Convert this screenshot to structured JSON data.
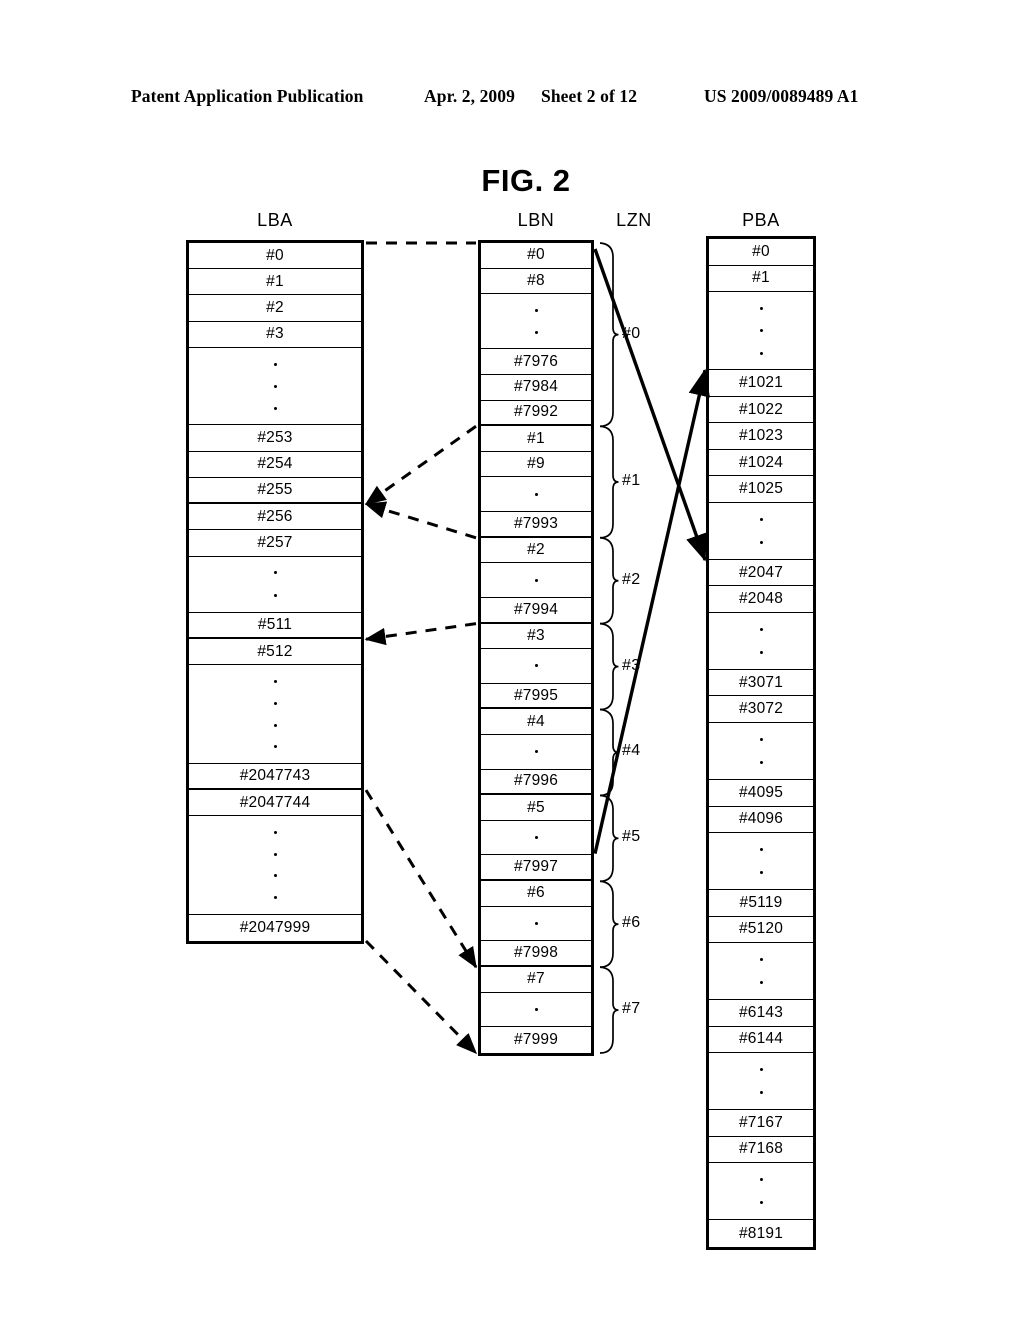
{
  "page_header": {
    "publication": "Patent Application Publication",
    "date": "Apr. 2, 2009",
    "sheet": "Sheet 2 of 12",
    "patent_number": "US 2009/0089489 A1"
  },
  "figure": {
    "title": "FIG. 2",
    "ink_color": "#000000",
    "background": "#ffffff"
  },
  "columns": {
    "lba": {
      "caption": "LBA",
      "cells": [
        {
          "label": "#0"
        },
        {
          "label": "#1"
        },
        {
          "label": "#2"
        },
        {
          "label": "#3"
        },
        {
          "label": "",
          "dots": 3
        },
        {
          "label": "#253"
        },
        {
          "label": "#254"
        },
        {
          "label": "#255",
          "group_end": true
        },
        {
          "label": "#256"
        },
        {
          "label": "#257"
        },
        {
          "label": "",
          "dots": 2
        },
        {
          "label": "#511",
          "group_end": true
        },
        {
          "label": "#512"
        },
        {
          "label": "",
          "dots": 4
        },
        {
          "label": "#2047743",
          "group_end": true
        },
        {
          "label": "#2047744"
        },
        {
          "label": "",
          "dots": 4
        },
        {
          "label": "#2047999"
        }
      ]
    },
    "lbn": {
      "caption": "LBN",
      "cells": [
        {
          "label": "#0"
        },
        {
          "label": "#8"
        },
        {
          "label": "",
          "dots": 2
        },
        {
          "label": "#7976"
        },
        {
          "label": "#7984"
        },
        {
          "label": "#7992",
          "group_end": true
        },
        {
          "label": "#1"
        },
        {
          "label": "#9"
        },
        {
          "label": "",
          "dots": 1
        },
        {
          "label": "#7993",
          "group_end": true
        },
        {
          "label": "#2"
        },
        {
          "label": "",
          "dots": 1
        },
        {
          "label": "#7994",
          "group_end": true
        },
        {
          "label": "#3"
        },
        {
          "label": "",
          "dots": 1
        },
        {
          "label": "#7995",
          "group_end": true
        },
        {
          "label": "#4"
        },
        {
          "label": "",
          "dots": 1
        },
        {
          "label": "#7996",
          "group_end": true
        },
        {
          "label": "#5"
        },
        {
          "label": "",
          "dots": 1
        },
        {
          "label": "#7997",
          "group_end": true
        },
        {
          "label": "#6"
        },
        {
          "label": "",
          "dots": 1
        },
        {
          "label": "#7998",
          "group_end": true
        },
        {
          "label": "#7"
        },
        {
          "label": "",
          "dots": 1
        },
        {
          "label": "#7999"
        }
      ]
    },
    "lzn": {
      "caption": "LZN",
      "zones": [
        {
          "label": "#0"
        },
        {
          "label": "#1"
        },
        {
          "label": "#2"
        },
        {
          "label": "#3"
        },
        {
          "label": "#4"
        },
        {
          "label": "#5"
        },
        {
          "label": "#6"
        },
        {
          "label": "#7"
        }
      ]
    },
    "pba": {
      "caption": "PBA",
      "cells": [
        {
          "label": "#0"
        },
        {
          "label": "#1"
        },
        {
          "label": "",
          "dots": 3
        },
        {
          "label": "#1021"
        },
        {
          "label": "#1022"
        },
        {
          "label": "#1023"
        },
        {
          "label": "#1024"
        },
        {
          "label": "#1025"
        },
        {
          "label": "",
          "dots": 2
        },
        {
          "label": "#2047"
        },
        {
          "label": "#2048"
        },
        {
          "label": "",
          "dots": 2
        },
        {
          "label": "#3071"
        },
        {
          "label": "#3072"
        },
        {
          "label": "",
          "dots": 2
        },
        {
          "label": "#4095"
        },
        {
          "label": "#4096"
        },
        {
          "label": "",
          "dots": 2
        },
        {
          "label": "#5119"
        },
        {
          "label": "#5120"
        },
        {
          "label": "",
          "dots": 2
        },
        {
          "label": "#6143"
        },
        {
          "label": "#6144"
        },
        {
          "label": "",
          "dots": 2
        },
        {
          "label": "#7167"
        },
        {
          "label": "#7168"
        },
        {
          "label": "",
          "dots": 2
        },
        {
          "label": "#8191"
        }
      ]
    }
  }
}
